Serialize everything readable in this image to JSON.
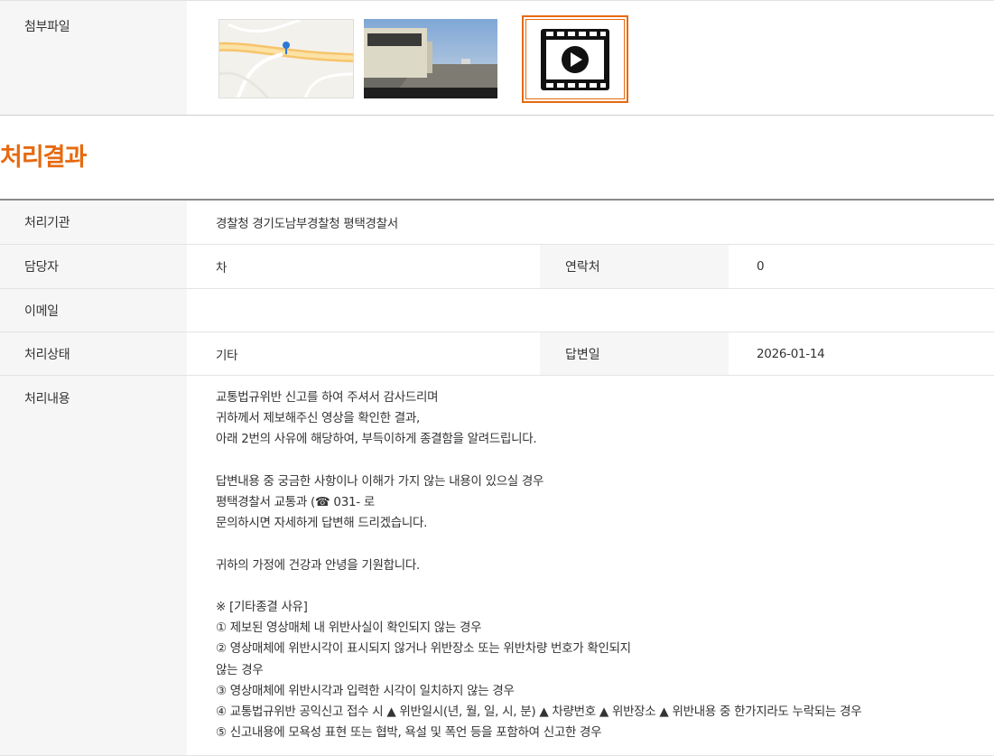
{
  "attachments": {
    "label": "첨부파일",
    "items": [
      {
        "type": "map-thumbnail"
      },
      {
        "type": "photo-thumbnail"
      },
      {
        "type": "video-thumbnail",
        "icon": "film-play-icon"
      }
    ],
    "accent": "#e66a10"
  },
  "result": {
    "title": "처리결과",
    "agency_label": "처리기관",
    "agency": "경찰청 경기도남부경찰청 평택경찰서",
    "manager_label": "담당자",
    "manager": "차",
    "contact_label": "연락처",
    "contact": "0",
    "email_label": "이메일",
    "email": "",
    "status_label": "처리상태",
    "status": "기타",
    "answer_date_label": "답변일",
    "answer_date": "2026-01-14",
    "content_label": "처리내용",
    "content_lines": [
      "교통법규위반 신고를 하여 주셔서 감사드리며",
      "귀하께서 제보해주신 영상을 확인한 결과,",
      "아래 2번의 사유에 해당하여, 부득이하게 종결함을 알려드립니다.",
      "",
      "답변내용 중 궁금한 사항이나 이해가 가지 않는 내용이 있으실 경우",
      "평택경찰서 교통과 (☎ 031-  로",
      "문의하시면 자세하게 답변해 드리겠습니다.",
      "",
      "귀하의 가정에 건강과 안녕을 기원합니다.",
      "",
      "※ [기타종결 사유]",
      "① 제보된 영상매체 내 위반사실이 확인되지 않는 경우",
      "② 영상매체에 위반시각이 표시되지 않거나 위반장소 또는 위반차량 번호가 확인되지",
      "않는 경우",
      "③ 영상매체에 위반시각과 입력한 시각이 일치하지 않는 경우",
      "④ 교통법규위반 공익신고 접수 시 ▲ 위반일시(년, 월, 일, 시, 분) ▲ 차량번호 ▲ 위반장소 ▲ 위반내용 중 한가지라도 누락되는 경우",
      "⑤ 신고내용에 모욕성 표현 또는 협박, 욕설 및 폭언 등을 포함하여 신고한 경우"
    ]
  }
}
